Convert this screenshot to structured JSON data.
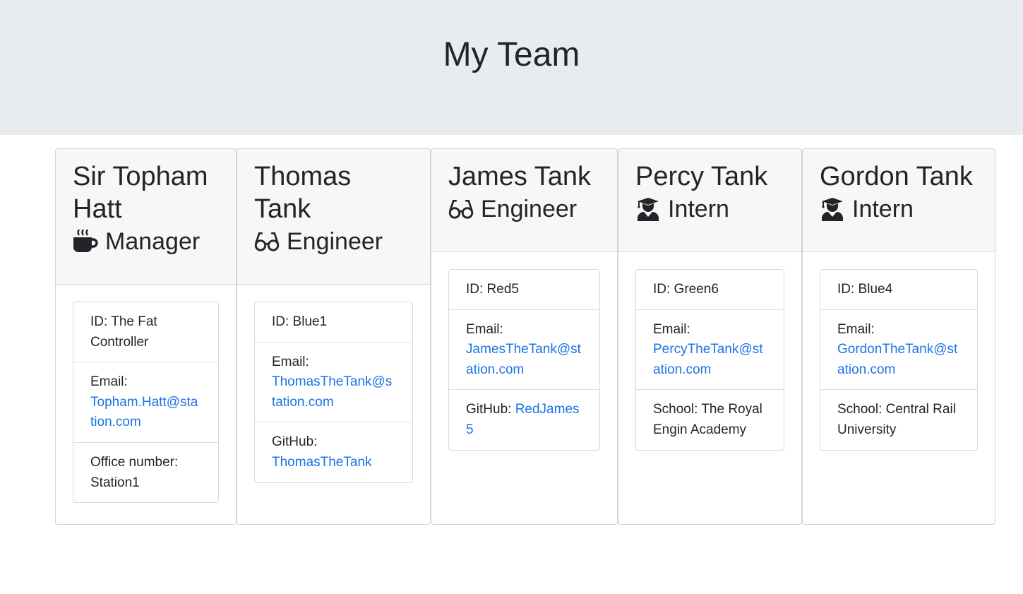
{
  "header": {
    "title": "My Team"
  },
  "members": [
    {
      "name": "Sir Topham Hatt",
      "role": "Manager",
      "role_icon": "mug-icon",
      "id_text": "ID: The Fat Controller",
      "email_label": "Email:",
      "email": "Topham.Hatt@station.com",
      "extra_label": "Office number:",
      "extra_value": "Station1"
    },
    {
      "name": "Thomas Tank",
      "role": "Engineer",
      "role_icon": "glasses-icon",
      "id_text": "ID: Blue1",
      "email_label": "Email:",
      "email": "ThomasTheTank@station.com",
      "extra_label": "GitHub:",
      "extra_value": "ThomasTheTank"
    },
    {
      "name": "James Tank",
      "role": "Engineer",
      "role_icon": "glasses-icon",
      "id_text": "ID: Red5",
      "email_label": "Email:",
      "email": "JamesTheTank@station.com",
      "extra_label": "GitHub:",
      "extra_value": "RedJames5"
    },
    {
      "name": "Percy Tank",
      "role": "Intern",
      "role_icon": "graduate-icon",
      "id_text": "ID: Green6",
      "email_label": "Email:",
      "email": "PercyTheTank@station.com",
      "extra_label": "School:",
      "extra_value": "The Royal Engin Academy"
    },
    {
      "name": "Gordon Tank",
      "role": "Intern",
      "role_icon": "graduate-icon",
      "id_text": "ID: Blue4",
      "email_label": "Email:",
      "email": "GordonTheTank@station.com",
      "extra_label": "School:",
      "extra_value": "Central Rail University"
    }
  ],
  "colors": {
    "link": "#1a73e8",
    "jumbotron": "#e9ecef",
    "card_header": "#f7f7f7"
  }
}
